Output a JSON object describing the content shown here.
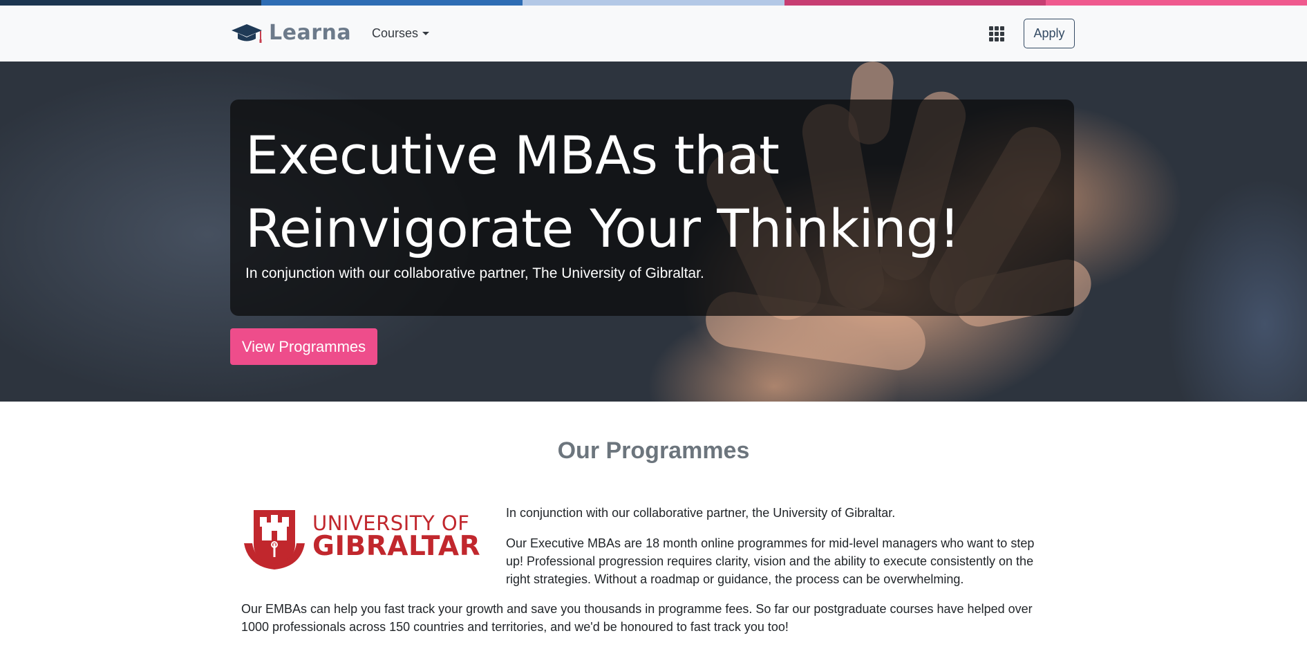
{
  "stripe_colors": [
    "#1c3550",
    "#2e6db4",
    "#b3c8e6",
    "#c73e72",
    "#ef5a8e"
  ],
  "nav": {
    "brand_name": "Learna",
    "brand_icon": "graduation-cap-icon",
    "courses_label": "Courses",
    "apps_icon": "grid-icon",
    "apply_label": "Apply"
  },
  "hero": {
    "title": "Executive MBAs that Reinvigorate Your Thinking!",
    "subtitle": "In conjunction with our collaborative partner, The University of Gibraltar.",
    "cta_label": "View Programmes",
    "cta_color": "#ee4d8b"
  },
  "programmes": {
    "heading": "Our Programmes",
    "logo_line1": "UNIVERSITY OF",
    "logo_line2": "GIBRALTAR",
    "logo_color": "#c1272d",
    "intro": "In conjunction with our collaborative partner, the University of Gibraltar.",
    "description": "Our Executive MBAs are 18 month online programmes for mid-level managers who want to step up! Professional progression requires clarity, vision and the ability to execute consistently on the right strategies. Without a roadmap or guidance, the process can be overwhelming.",
    "closing": "Our EMBAs can help you fast track your growth and save you thousands in programme fees. So far our postgraduate courses have helped over 1000 professionals across 150 countries and territories, and we'd be honoured to fast track you too!"
  }
}
